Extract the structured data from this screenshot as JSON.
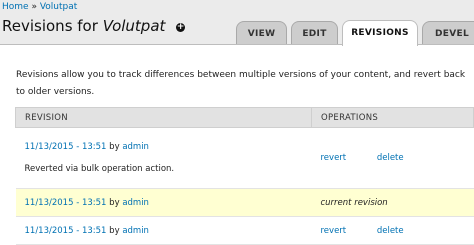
{
  "breadcrumb": {
    "home": "Home",
    "separator": "»",
    "section": "Volutpat"
  },
  "page": {
    "title_prefix": "Revisions for",
    "title_node": "Volutpat",
    "shortcut_glyph": "+"
  },
  "tabs": [
    {
      "label": "VIEW",
      "active": false
    },
    {
      "label": "EDIT",
      "active": false
    },
    {
      "label": "REVISIONS",
      "active": true
    },
    {
      "label": "DEVEL",
      "active": false
    }
  ],
  "description": "Revisions allow you to track differences between multiple versions of your content, and revert back to older versions.",
  "table": {
    "headers": {
      "revision": "REVISION",
      "operations": "OPERATIONS"
    },
    "rows": [
      {
        "date": "11/13/2015 - 13:51",
        "by": "by",
        "author": "admin",
        "log": "Reverted via bulk operation action.",
        "revert": "revert",
        "delete": "delete"
      },
      {
        "date": "11/13/2015 - 13:51",
        "by": "by",
        "author": "admin",
        "status": "current revision"
      },
      {
        "date": "11/13/2015 - 13:51",
        "by": "by",
        "author": "admin",
        "revert": "revert",
        "delete": "delete"
      }
    ]
  },
  "colors": {
    "link": "#0071b3",
    "current_row": "#ffffd2",
    "header_bg": "#ebebeb",
    "tab_bg": "#cdcdcd"
  }
}
